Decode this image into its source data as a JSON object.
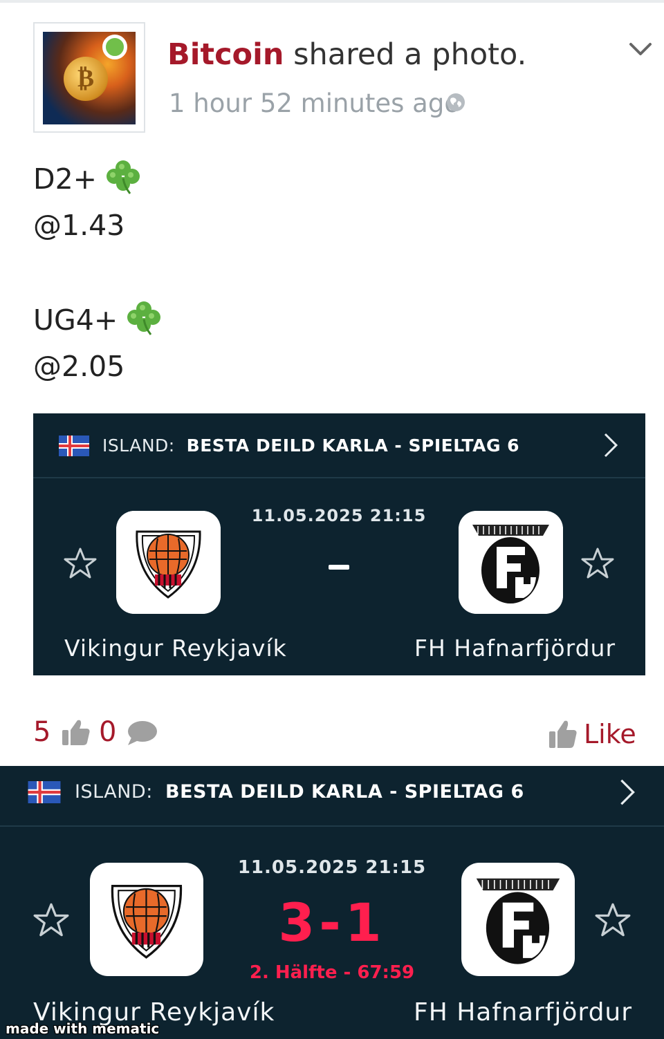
{
  "post": {
    "author": "Bitcoin",
    "action": " shared a photo.",
    "time": "1 hour 52 minutes ago",
    "lines": [
      "D2+",
      "@1.43",
      "UG4+",
      "@2.05"
    ]
  },
  "match_card": {
    "country": "ISLAND:",
    "league": "BESTA DEILD KARLA - SPIELTAG 6",
    "datetime": "11.05.2025 21:15",
    "home_team": "Vikingur Reykjavík",
    "away_team": "FH Hafnarfjördur",
    "score_placeholder": "-"
  },
  "engagement": {
    "likes": "5",
    "comments": "0",
    "like_label": "Like"
  },
  "result_card": {
    "country": "ISLAND:",
    "league": "BESTA DEILD KARLA - SPIELTAG 6",
    "datetime": "11.05.2025 21:15",
    "score": "3-1",
    "status": "2. Hälfte - 67:59",
    "home_team": "Vikingur Reykjavík",
    "away_team": "FH Hafnarfjördur"
  },
  "watermark": "made with mematic",
  "colors": {
    "brand_red": "#a5192a",
    "card_bg": "#0d232f",
    "live_red": "#ff1f4e",
    "online_green": "#71bf4a"
  },
  "icons": [
    "chevron-down-icon",
    "globe-icon",
    "clover-icon",
    "flag-iceland-icon",
    "chevron-right-icon",
    "star-icon",
    "thumbs-up-icon",
    "comment-bubble-icon"
  ]
}
